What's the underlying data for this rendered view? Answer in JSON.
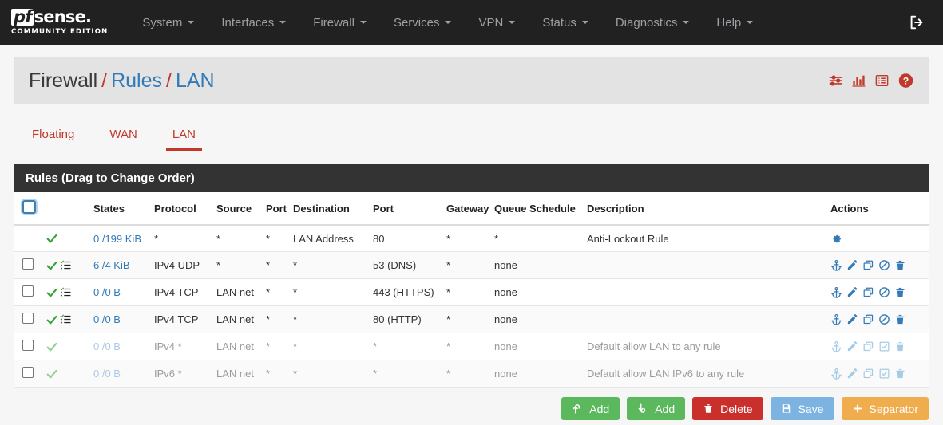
{
  "navbar": {
    "logo_pf": "pf",
    "logo_sense": "sense.",
    "logo_subtitle": "COMMUNITY EDITION",
    "items": [
      {
        "label": "System"
      },
      {
        "label": "Interfaces"
      },
      {
        "label": "Firewall"
      },
      {
        "label": "Services"
      },
      {
        "label": "VPN"
      },
      {
        "label": "Status"
      },
      {
        "label": "Diagnostics"
      },
      {
        "label": "Help"
      }
    ],
    "logout_icon": "logout-icon"
  },
  "header": {
    "breadcrumb": {
      "root": "Firewall",
      "sep": "/",
      "section": "Rules",
      "page": "LAN"
    },
    "icons": [
      {
        "name": "filter-sliders-icon"
      },
      {
        "name": "bar-chart-icon"
      },
      {
        "name": "list-icon"
      },
      {
        "name": "help-circle-icon"
      }
    ],
    "accent_color": "#c0392b"
  },
  "tabs": [
    {
      "label": "Floating",
      "active": false
    },
    {
      "label": "WAN",
      "active": false
    },
    {
      "label": "LAN",
      "active": true
    }
  ],
  "panel": {
    "title": "Rules (Drag to Change Order)",
    "columns": [
      "",
      "",
      "States",
      "Protocol",
      "Source",
      "Port",
      "Destination",
      "Port",
      "Gateway",
      "Queue",
      "Schedule",
      "Description",
      "Actions"
    ],
    "rows": [
      {
        "checkbox": false,
        "status": "pass",
        "has_advanced": false,
        "states": "0 /199 KiB",
        "protocol": "*",
        "source": "*",
        "port_src": "*",
        "destination": "LAN Address",
        "port_dst": "80",
        "gateway": "*",
        "queue": "*",
        "schedule": "",
        "description": "Anti-Lockout Rule",
        "actions": [
          "gear-icon"
        ],
        "dim": false
      },
      {
        "checkbox": true,
        "status": "pass",
        "has_advanced": true,
        "states": "6 /4 KiB",
        "protocol": "IPv4 UDP",
        "source": "*",
        "port_src": "*",
        "destination": "*",
        "port_dst": "53 (DNS)",
        "gateway": "*",
        "queue": "none",
        "schedule": "",
        "description": "",
        "actions": [
          "anchor-icon",
          "pencil-icon",
          "copy-icon",
          "ban-icon",
          "trash-icon"
        ],
        "dim": false
      },
      {
        "checkbox": true,
        "status": "pass",
        "has_advanced": true,
        "states": "0 /0 B",
        "protocol": "IPv4 TCP",
        "source": "LAN net",
        "port_src": "*",
        "destination": "*",
        "port_dst": "443 (HTTPS)",
        "gateway": "*",
        "queue": "none",
        "schedule": "",
        "description": "",
        "actions": [
          "anchor-icon",
          "pencil-icon",
          "copy-icon",
          "ban-icon",
          "trash-icon"
        ],
        "dim": false
      },
      {
        "checkbox": true,
        "status": "pass",
        "has_advanced": true,
        "states": "0 /0 B",
        "protocol": "IPv4 TCP",
        "source": "LAN net",
        "port_src": "*",
        "destination": "*",
        "port_dst": "80 (HTTP)",
        "gateway": "*",
        "queue": "none",
        "schedule": "",
        "description": "",
        "actions": [
          "anchor-icon",
          "pencil-icon",
          "copy-icon",
          "ban-icon",
          "trash-icon"
        ],
        "dim": false
      },
      {
        "checkbox": true,
        "status": "pass",
        "has_advanced": false,
        "states": "0 /0 B",
        "protocol": "IPv4 *",
        "source": "LAN net",
        "port_src": "*",
        "destination": "*",
        "port_dst": "*",
        "gateway": "*",
        "queue": "none",
        "schedule": "",
        "description": "Default allow LAN to any rule",
        "actions": [
          "anchor-icon",
          "pencil-icon",
          "copy-icon",
          "checkbox-check-icon",
          "trash-icon"
        ],
        "dim": true
      },
      {
        "checkbox": true,
        "status": "pass",
        "has_advanced": false,
        "states": "0 /0 B",
        "protocol": "IPv6 *",
        "source": "LAN net",
        "port_src": "*",
        "destination": "*",
        "port_dst": "*",
        "gateway": "*",
        "queue": "none",
        "schedule": "",
        "description": "Default allow LAN IPv6 to any rule",
        "actions": [
          "anchor-icon",
          "pencil-icon",
          "copy-icon",
          "checkbox-check-icon",
          "trash-icon"
        ],
        "dim": true
      }
    ]
  },
  "footer_buttons": [
    {
      "label": "Add",
      "icon": "arrow-up-icon",
      "color": "#5cb85c",
      "style": "btn-green"
    },
    {
      "label": "Add",
      "icon": "arrow-down-icon",
      "color": "#5cb85c",
      "style": "btn-green"
    },
    {
      "label": "Delete",
      "icon": "trash-icon",
      "color": "#c9302c",
      "style": "btn-red"
    },
    {
      "label": "Save",
      "icon": "floppy-disk-icon",
      "color": "#7cb3e0",
      "style": "btn-blue"
    },
    {
      "label": "Separator",
      "icon": "plus-icon",
      "color": "#efad4e",
      "style": "btn-orange"
    }
  ],
  "colors": {
    "navbar_bg": "#212121",
    "accent_red": "#c0392b",
    "link_blue": "#337ab7",
    "pass_green": "#5cb85c",
    "panel_head_bg": "#333333"
  }
}
